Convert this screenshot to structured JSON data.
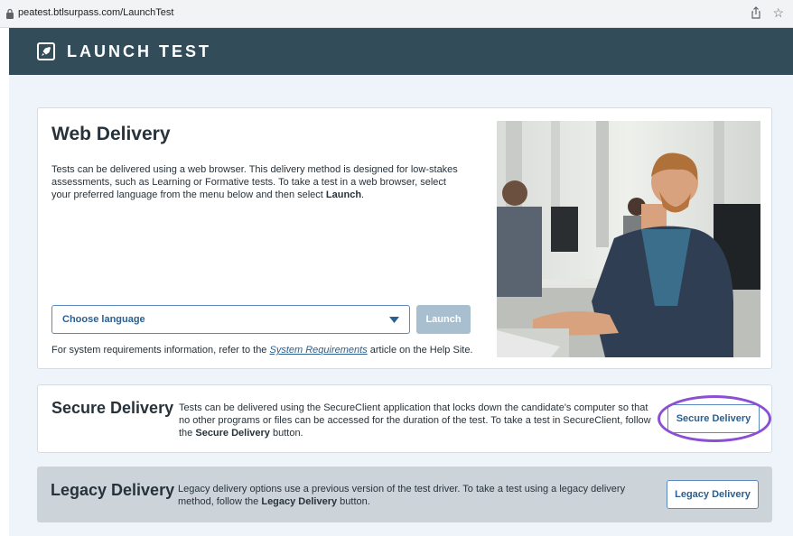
{
  "browser": {
    "url": "peatest.btlsurpass.com/LaunchTest"
  },
  "header": {
    "title": "LAUNCH TEST"
  },
  "web_delivery": {
    "title": "Web Delivery",
    "desc_text": "Tests can be delivered using a web browser. This delivery method is designed for low-stakes assessments, such as Learning or Formative tests. To take a test in a web browser, select your preferred language from the menu below and then select ",
    "desc_bold": "Launch",
    "desc_end": ".",
    "language_placeholder": "Choose language",
    "launch_label": "Launch",
    "sysreq_prefix": "For system requirements information, refer to the ",
    "sysreq_link": "System Requirements",
    "sysreq_suffix": " article on the Help Site."
  },
  "secure_delivery": {
    "title": "Secure Delivery",
    "desc_text": "Tests can be delivered using the SecureClient application that locks down the candidate's computer so that no other programs or files can be accessed for the duration of the test. To take a test in SecureClient, follow the ",
    "desc_bold": "Secure Delivery",
    "desc_end": " button.",
    "button_label": "Secure Delivery"
  },
  "legacy_delivery": {
    "title": "Legacy Delivery",
    "desc_text": "Legacy delivery options use a previous version of the test driver. To take a test using a legacy delivery method, follow the ",
    "desc_bold": "Legacy Delivery",
    "desc_end": " button.",
    "button_label": "Legacy Delivery"
  },
  "colors": {
    "header_bg": "#334c5a",
    "page_bg": "#eef4fa",
    "accent": "#2b5f8f",
    "annotation": "#8a4fd3"
  }
}
